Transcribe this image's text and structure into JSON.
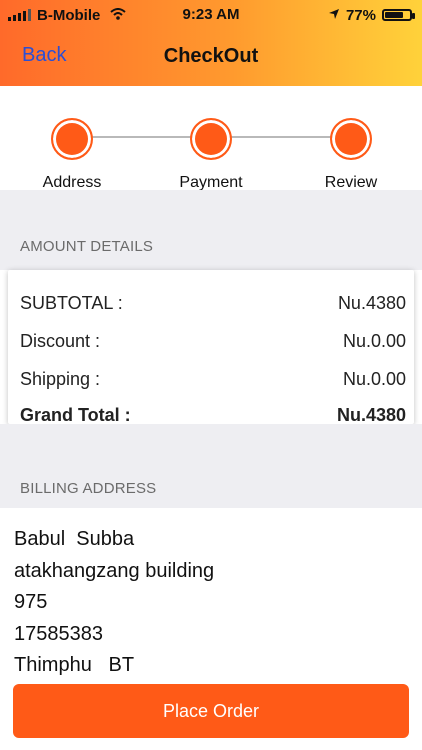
{
  "status_bar": {
    "carrier": "B-Mobile",
    "time": "9:23 AM",
    "battery": "77%",
    "icons": [
      "signal-icon",
      "wifi-icon",
      "location-arrow-icon",
      "battery-icon"
    ]
  },
  "nav": {
    "back_label": "Back",
    "title": "CheckOut"
  },
  "steps": [
    {
      "label": "Address"
    },
    {
      "label": "Payment"
    },
    {
      "label": "Review"
    }
  ],
  "amount": {
    "section_title": "AMOUNT DETAILS",
    "rows": [
      {
        "label": "SUBTOTAL :",
        "value": "Nu.4380"
      },
      {
        "label": "Discount :",
        "value": "Nu.0.00"
      },
      {
        "label": "Shipping :",
        "value": "Nu.0.00"
      }
    ],
    "grand_total_label": "Grand Total :",
    "grand_total_value": "Nu.4380"
  },
  "billing": {
    "section_title": "BILLING ADDRESS",
    "lines": [
      "Babul  Subba",
      "atakhangzang building",
      "975",
      "17585383",
      "Thimphu   BT"
    ]
  },
  "place_order_label": "Place Order",
  "colors": {
    "accent": "#ff5a17",
    "link": "#2a4fd6",
    "header_gradient_start": "#ff6a2a",
    "header_gradient_end": "#ffd23a",
    "section_bg": "#eeeef2"
  }
}
